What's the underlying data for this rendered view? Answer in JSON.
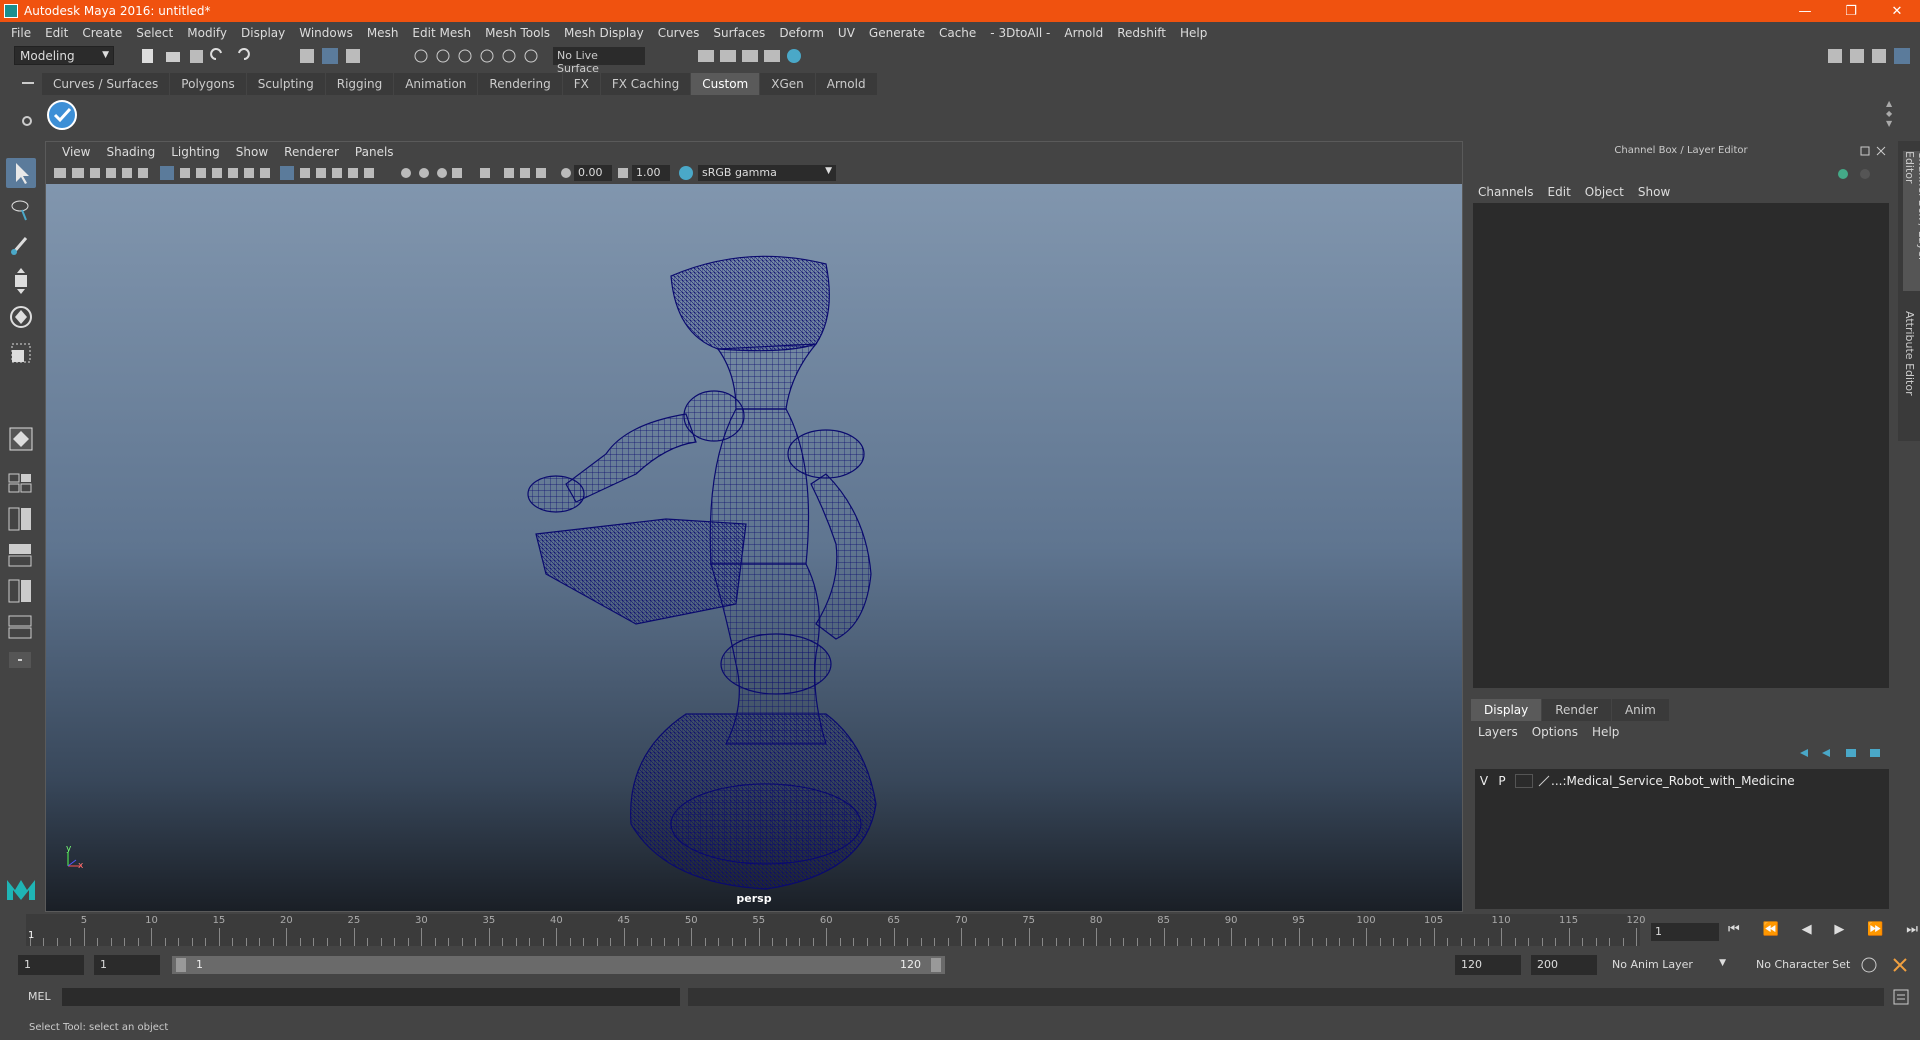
{
  "window": {
    "title": "Autodesk Maya 2016: untitled*",
    "minimize": "—",
    "restore": "❐",
    "close": "✕"
  },
  "menubar": [
    "File",
    "Edit",
    "Create",
    "Select",
    "Modify",
    "Display",
    "Windows",
    "Mesh",
    "Edit Mesh",
    "Mesh Tools",
    "Mesh Display",
    "Curves",
    "Surfaces",
    "Deform",
    "UV",
    "Generate",
    "Cache",
    "- 3DtoAll -",
    "Arnold",
    "Redshift",
    "Help"
  ],
  "statusline": {
    "mode": "Modeling",
    "live_surface": "No Live Surface"
  },
  "shelf": {
    "tabs": [
      "Curves / Surfaces",
      "Polygons",
      "Sculpting",
      "Rigging",
      "Animation",
      "Rendering",
      "FX",
      "FX Caching",
      "Custom",
      "XGen",
      "Arnold"
    ],
    "active_tab": "Custom"
  },
  "viewport": {
    "menu": [
      "View",
      "Shading",
      "Lighting",
      "Show",
      "Renderer",
      "Panels"
    ],
    "exposure": "0.00",
    "gamma": "1.00",
    "color_space": "sRGB gamma",
    "camera": "persp",
    "axis_y": "y",
    "axis_x": "x",
    "wireframe_color": "#0a0a6e"
  },
  "channelbox": {
    "title": "Channel Box / Layer Editor",
    "menu": [
      "Channels",
      "Edit",
      "Object",
      "Show"
    ],
    "layer_tabs": [
      "Display",
      "Render",
      "Anim"
    ],
    "active_layer_tab": "Display",
    "layer_menu": [
      "Layers",
      "Options",
      "Help"
    ],
    "layer": {
      "v": "V",
      "p": "P",
      "name": "...:Medical_Service_Robot_with_Medicine"
    }
  },
  "sidetabs": {
    "channel_box": "Channel Box / Layer Editor",
    "attribute_editor": "Attribute Editor"
  },
  "timeslider": {
    "start": 1,
    "end": 120,
    "ticks": [
      5,
      10,
      15,
      20,
      25,
      30,
      35,
      40,
      45,
      50,
      55,
      60,
      65,
      70,
      75,
      80,
      85,
      90,
      95,
      100,
      105,
      110,
      115,
      120
    ],
    "current_frame_label": "1",
    "current_frame": "1"
  },
  "playback": {
    "first": "⏮",
    "prev_key": "⏪",
    "prev_frame": "◀",
    "play": "▶",
    "next_key": "⏩",
    "last": "⏭"
  },
  "range": {
    "start_time": "1",
    "playback_start": "1",
    "slider_start": "1",
    "slider_end": "120",
    "playback_end": "120",
    "end_time": "200",
    "anim_layer": "No Anim Layer",
    "character_set": "No Character Set"
  },
  "cmdline": {
    "label": "MEL"
  },
  "helpline": {
    "text": "Select Tool: select an object"
  }
}
